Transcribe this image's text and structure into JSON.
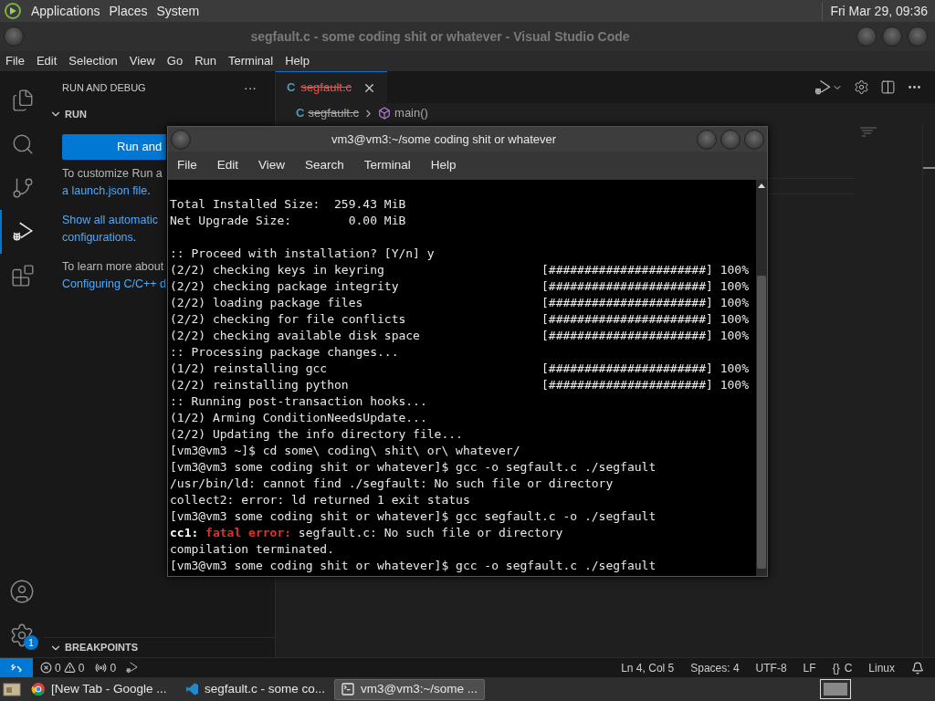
{
  "top_panel": {
    "menus": [
      "Applications",
      "Places",
      "System"
    ],
    "clock": "Fri Mar 29, 09:36"
  },
  "vscode": {
    "title": "segfault.c - some coding shit or whatever - Visual Studio Code",
    "menu": [
      "File",
      "Edit",
      "Selection",
      "View",
      "Go",
      "Run",
      "Terminal",
      "Help"
    ],
    "activity_bar": [
      {
        "kind": "explorer",
        "selected": false
      },
      {
        "kind": "search",
        "selected": false
      },
      {
        "kind": "source_control",
        "selected": false
      },
      {
        "kind": "run_debug",
        "selected": true
      },
      {
        "kind": "extensions",
        "selected": false
      }
    ],
    "settings_badge": "1",
    "sidebar": {
      "title": "RUN AND DEBUG",
      "more": "···",
      "section": {
        "label": "RUN",
        "expanded": true
      },
      "button": "Run and",
      "paragraphs": [
        [
          [
            {
              "text": "To customize Run a",
              "link": false
            }
          ],
          [
            {
              "text": "a launch.json file",
              "link": true
            },
            {
              "text": ".",
              "link": false
            }
          ]
        ],
        [
          [
            {
              "text": "Show all automatic",
              "link": true
            }
          ],
          [
            {
              "text": "configurations",
              "link": true
            },
            {
              "text": ".",
              "link": false
            }
          ]
        ],
        [
          [
            {
              "text": "To learn more about",
              "link": false
            }
          ],
          [
            {
              "text": "Configuring C/C++ d",
              "link": true
            }
          ]
        ]
      ],
      "breakpoints": {
        "label": "BREAKPOINTS",
        "expanded": true
      }
    },
    "tabs": [
      {
        "icon": "C",
        "label": "segfault.c",
        "deleted": true,
        "selected": true
      }
    ],
    "breadcrumb": {
      "icon": "C",
      "file": "segfault.c",
      "symbol": "main()"
    },
    "status_bar": {
      "errors": "0",
      "warnings": "0",
      "ports": "0",
      "right": [
        "Ln 4, Col 5",
        "Spaces: 4",
        "UTF-8",
        "LF"
      ],
      "language_icon": "{}",
      "language": "C",
      "os": "Linux"
    }
  },
  "terminal": {
    "title": "vm3@vm3:~/some coding shit or whatever",
    "menu": [
      "File",
      "Edit",
      "View",
      "Search",
      "Terminal",
      "Help"
    ],
    "lines": [
      {
        "kind": "blank"
      },
      {
        "kind": "text",
        "text": "Total Installed Size:  259.43 MiB"
      },
      {
        "kind": "text",
        "text": "Net Upgrade Size:        0.00 MiB"
      },
      {
        "kind": "blank"
      },
      {
        "kind": "text",
        "text": ":: Proceed with installation? [Y/n] y"
      },
      {
        "kind": "text",
        "text": "(2/2) checking keys in keyring                      [######################] 100%"
      },
      {
        "kind": "text",
        "text": "(2/2) checking package integrity                    [######################] 100%"
      },
      {
        "kind": "text",
        "text": "(2/2) loading package files                         [######################] 100%"
      },
      {
        "kind": "text",
        "text": "(2/2) checking for file conflicts                   [######################] 100%"
      },
      {
        "kind": "text",
        "text": "(2/2) checking available disk space                 [######################] 100%"
      },
      {
        "kind": "text",
        "text": ":: Processing package changes..."
      },
      {
        "kind": "text",
        "text": "(1/2) reinstalling gcc                              [######################] 100%"
      },
      {
        "kind": "text",
        "text": "(2/2) reinstalling python                           [######################] 100%"
      },
      {
        "kind": "text",
        "text": ":: Running post-transaction hooks..."
      },
      {
        "kind": "text",
        "text": "(1/2) Arming ConditionNeedsUpdate..."
      },
      {
        "kind": "text",
        "text": "(2/2) Updating the info directory file..."
      },
      {
        "kind": "text",
        "text": "[vm3@vm3 ~]$ cd some\\ coding\\ shit\\ or\\ whatever/"
      },
      {
        "kind": "text",
        "text": "[vm3@vm3 some coding shit or whatever]$ gcc -o segfault.c ./segfault"
      },
      {
        "kind": "text",
        "text": "/usr/bin/ld: cannot find ./segfault: No such file or directory"
      },
      {
        "kind": "text",
        "text": "collect2: error: ld returned 1 exit status"
      },
      {
        "kind": "text",
        "text": "[vm3@vm3 some coding shit or whatever]$ gcc segfault.c -o ./segfault"
      },
      {
        "kind": "parts",
        "parts": [
          "cc1:",
          "fatal error:",
          "segfault.c: No such file or directory"
        ]
      },
      {
        "kind": "text",
        "text": "compilation terminated."
      },
      {
        "kind": "text",
        "text": "[vm3@vm3 some coding shit or whatever]$ gcc -o segfault.c ./segfault"
      }
    ]
  },
  "taskbar": {
    "tasks": [
      {
        "kind": "browser",
        "label": "[New Tab - Google ...",
        "selected": false
      },
      {
        "kind": "editor",
        "label": "segfault.c - some co...",
        "selected": false
      },
      {
        "kind": "terminal",
        "label": "vm3@vm3:~/some ...",
        "selected": true
      }
    ]
  }
}
